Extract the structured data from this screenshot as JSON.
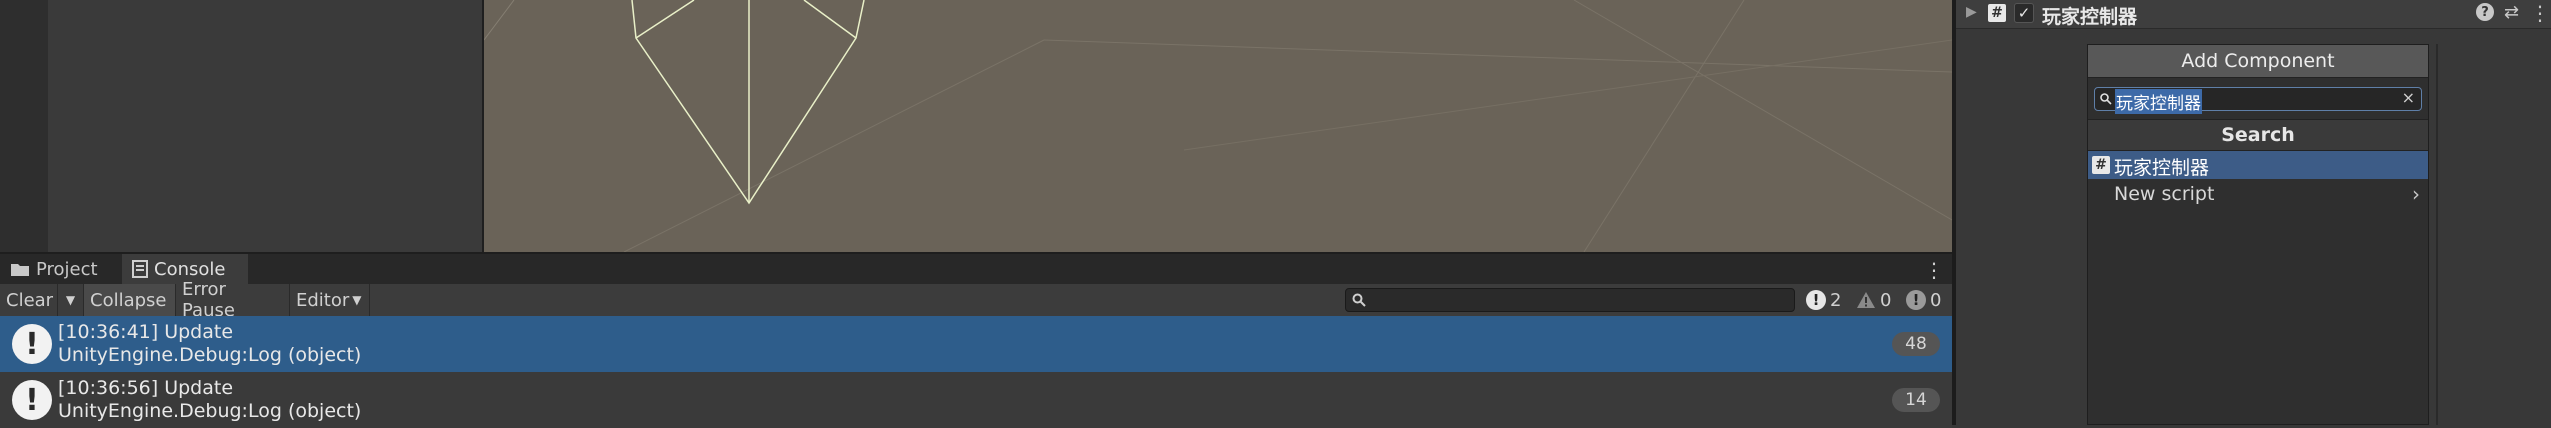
{
  "bottom_panel": {
    "tabs": [
      {
        "label": "Project"
      },
      {
        "label": "Console"
      }
    ],
    "toolbar": {
      "clear": "Clear",
      "collapse": "Collapse",
      "error_pause": "Error Pause",
      "editor": "Editor",
      "search_value": "",
      "log_count": "2",
      "warning_count": "0",
      "error_count": "0"
    },
    "log_rows": [
      {
        "line1": "[10:36:41] Update",
        "line2": "UnityEngine.Debug:Log (object)",
        "count": "48",
        "selected": true
      },
      {
        "line1": "[10:36:56] Update",
        "line2": "UnityEngine.Debug:Log (object)",
        "count": "14",
        "selected": false
      }
    ]
  },
  "inspector": {
    "component_title": "玩家控制器",
    "add_component_button": "Add Component",
    "search_value": "玩家控制器",
    "search_header": "Search",
    "results": [
      {
        "label": "玩家控制器",
        "icon": "script-hash-icon"
      },
      {
        "label": "New script",
        "icon": "chevron-right-icon"
      }
    ]
  },
  "colors": {
    "selection": "#2e5d8b",
    "popup_selection": "#3d5c87",
    "scene_background": "#6a6358",
    "panel": "#383838"
  }
}
